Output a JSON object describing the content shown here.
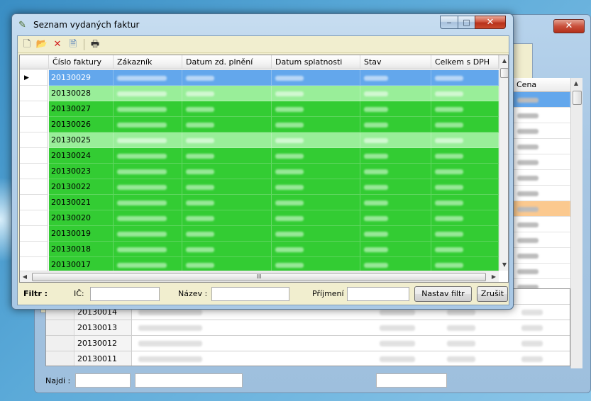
{
  "colors": {
    "row_default": "#33cc33",
    "row_light": "#99ee99",
    "row_selected": "#63a7ec",
    "rowhdr_selected": "#ffffff",
    "highlight_orange": "#fbc98f"
  },
  "background_window": {
    "close_label": "✕",
    "price_header": "Cena",
    "rows": [
      {
        "number": "20130014"
      },
      {
        "number": "20130013"
      },
      {
        "number": "20130012"
      },
      {
        "number": "20130011"
      }
    ],
    "find_label": "Najdi :"
  },
  "window": {
    "title": "Seznam vydaných faktur",
    "app_icon": "pen-icon",
    "minimize_label": "‒",
    "maximize_label": "□",
    "close_label": "✕"
  },
  "toolbar": {
    "buttons": [
      {
        "name": "new-icon",
        "glyph": "🗋"
      },
      {
        "name": "open-folder-icon",
        "glyph": "📂"
      },
      {
        "name": "delete-icon",
        "glyph": "✕"
      },
      {
        "name": "preview-icon",
        "glyph": "🗎"
      },
      {
        "name": "print-icon",
        "glyph": "🖶"
      }
    ]
  },
  "grid": {
    "current_row_marker": "▶",
    "columns": [
      "Číslo faktury",
      "Zákazník",
      "Datum zd. plnění",
      "Datum splatnosti",
      "Stav",
      "Celkem s DPH"
    ],
    "rows": [
      {
        "number": "20130029",
        "color": "selected"
      },
      {
        "number": "20130028",
        "color": "light"
      },
      {
        "number": "20130027",
        "color": "default"
      },
      {
        "number": "20130026",
        "color": "default"
      },
      {
        "number": "20130025",
        "color": "light"
      },
      {
        "number": "20130024",
        "color": "default"
      },
      {
        "number": "20130023",
        "color": "default"
      },
      {
        "number": "20130022",
        "color": "default"
      },
      {
        "number": "20130021",
        "color": "default"
      },
      {
        "number": "20130020",
        "color": "default"
      },
      {
        "number": "20130019",
        "color": "default"
      },
      {
        "number": "20130018",
        "color": "default"
      },
      {
        "number": "20130017",
        "color": "default"
      }
    ],
    "hscroll_grip": "III"
  },
  "filter": {
    "label": "Filtr :",
    "ic_label": "IČ:",
    "ic_value": "",
    "name_label": "Název :",
    "name_value": "",
    "surname_label": "Příjmení :",
    "surname_value": "",
    "apply_button": "Nastav filtr",
    "cancel_button": "Zrušit"
  }
}
